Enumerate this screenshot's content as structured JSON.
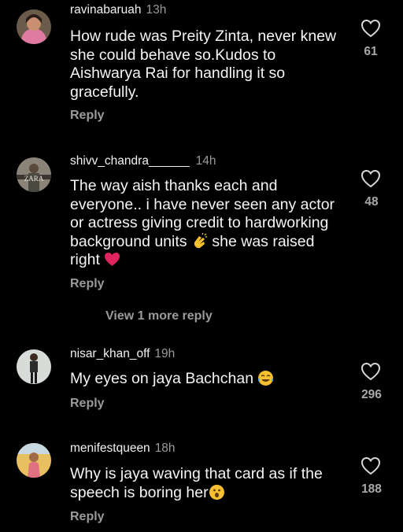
{
  "comments": [
    {
      "username": "ravinabaruah",
      "time": "13h",
      "text": "How rude was Preity Zinta, never knew she could behave so.Kudos to Aishwarya Rai for handling it so gracefully.",
      "reply_label": "Reply",
      "likes": "61",
      "like_icon": "heart-outline-icon"
    },
    {
      "username": "shivv_chandra______",
      "time": "14h",
      "text_lines": [
        "The way aish thanks each and",
        "everyone.. i have never seen any actor",
        "or actress giving credit to hardworking",
        "background units",
        "she was raised",
        "right"
      ],
      "emoji_1": "clapping-hands-emoji",
      "emoji_2": "red-heart-emoji",
      "reply_label": "Reply",
      "likes": "48",
      "view_more": "View 1 more reply"
    },
    {
      "username": "nisar_khan_off",
      "time": "19h",
      "text": "My eyes on jaya Bachchan",
      "emoji": "tears-of-joy-emoji",
      "reply_label": "Reply",
      "likes": "296"
    },
    {
      "username": "menifestqueen",
      "time": "18h",
      "text_lines": [
        "Why is jaya waving that card as if the",
        "speech is boring her"
      ],
      "emoji": "surprised-face-emoji",
      "reply_label": "Reply",
      "likes": "188"
    }
  ],
  "colors": {
    "background": "#000000",
    "primary_text": "#f5f5f5",
    "secondary_text": "#9a9a9a",
    "heart_emoji": "#e0245e"
  }
}
